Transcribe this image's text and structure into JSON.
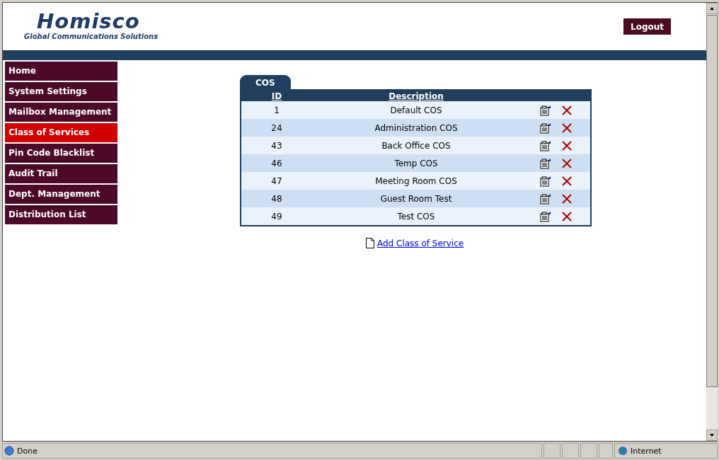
{
  "header": {
    "logo": "Homisco",
    "tagline": "Global Communications Solutions",
    "logout": "Logout"
  },
  "nav": [
    {
      "label": "Home",
      "selected": false
    },
    {
      "label": "System Settings",
      "selected": false
    },
    {
      "label": "Mailbox Management",
      "selected": false
    },
    {
      "label": "Class of Services",
      "selected": true
    },
    {
      "label": "Pin Code Blacklist",
      "selected": false
    },
    {
      "label": "Audit Trail",
      "selected": false
    },
    {
      "label": "Dept. Management",
      "selected": false
    },
    {
      "label": "Distribution List",
      "selected": false
    }
  ],
  "table": {
    "tab": "COS",
    "columns": [
      "ID",
      "Description"
    ],
    "rows": [
      {
        "id": "1",
        "description": "Default COS"
      },
      {
        "id": "24",
        "description": "Administration COS"
      },
      {
        "id": "43",
        "description": "Back Office COS"
      },
      {
        "id": "46",
        "description": "Temp COS"
      },
      {
        "id": "47",
        "description": "Meeting Room COS"
      },
      {
        "id": "48",
        "description": "Guest Room Test"
      },
      {
        "id": "49",
        "description": "Test COS"
      }
    ]
  },
  "add_link": "Add Class of Service",
  "status_bar": {
    "status": "Done",
    "zone": "Internet"
  }
}
